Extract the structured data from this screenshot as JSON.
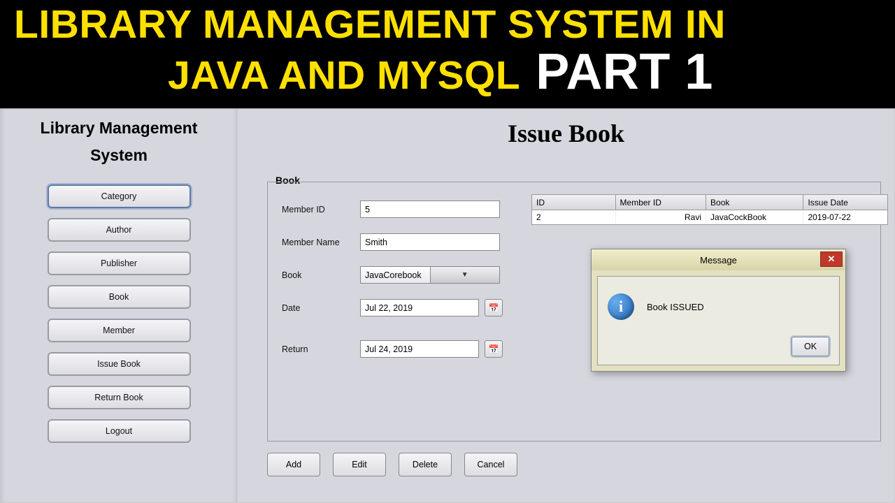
{
  "banner": {
    "line1": "LIBRARY MANAGEMENT SYSTEM IN",
    "line2a": "JAVA AND MYSQL",
    "line2b": "PART 1"
  },
  "sidebar": {
    "title_line1": "Library Management",
    "title_line2": "System",
    "items": [
      {
        "label": "Category",
        "active": true
      },
      {
        "label": "Author"
      },
      {
        "label": "Publisher"
      },
      {
        "label": "Book"
      },
      {
        "label": "Member"
      },
      {
        "label": "Issue Book"
      },
      {
        "label": "Return Book"
      },
      {
        "label": "Logout"
      }
    ]
  },
  "main": {
    "title": "Issue Book",
    "legend": "Book",
    "form": {
      "member_id_label": "Member ID",
      "member_id_value": "5",
      "member_name_label": "Member Name",
      "member_name_value": "Smith",
      "book_label": "Book",
      "book_value": "JavaCorebook",
      "date_label": "Date",
      "date_value": "Jul 22, 2019",
      "return_label": "Return",
      "return_value": "Jul 24, 2019"
    },
    "table": {
      "headers": {
        "id": "ID",
        "member_id": "Member ID",
        "book": "Book",
        "issue_date": "Issue Date"
      },
      "rows": [
        {
          "id": "2",
          "member_id": "Ravi",
          "book": "JavaCockBook",
          "issue_date": "2019-07-22"
        }
      ]
    },
    "actions": {
      "add": "Add",
      "edit": "Edit",
      "delete": "Delete",
      "cancel": "Cancel"
    }
  },
  "dialog": {
    "title": "Message",
    "message": "Book ISSUED",
    "ok": "OK"
  }
}
